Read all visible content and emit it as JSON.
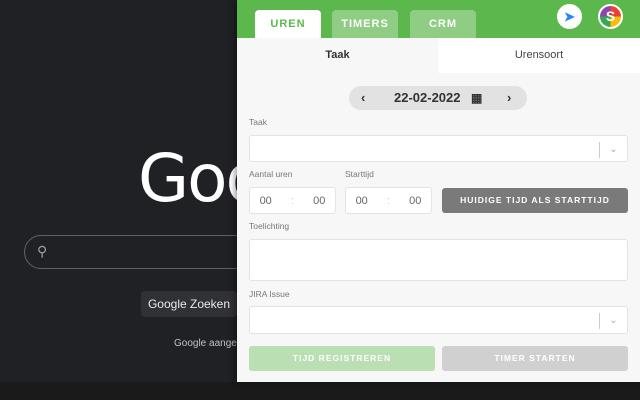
{
  "background": {
    "logo": "Goo",
    "search_icon": "search-icon",
    "search_button": "Google Zoeken",
    "language_text": "Google aangeb"
  },
  "header": {
    "tabs": [
      {
        "label": "UREN",
        "active": true
      },
      {
        "label": "TIMERS"
      },
      {
        "label": "CRM"
      }
    ],
    "jira_icon": "jira-icon",
    "avatar_letter": "S"
  },
  "subtabs": [
    {
      "label": "Taak"
    },
    {
      "label": "Urensoort"
    }
  ],
  "date": {
    "value": "22-02-2022",
    "prev": "‹",
    "next": "›",
    "calendar_icon": "▦"
  },
  "form": {
    "taak_label": "Taak",
    "aantal_uren_label": "Aantal uren",
    "aantal_uren": {
      "hours": "00",
      "minutes": "00"
    },
    "starttijd_label": "Starttijd",
    "starttijd": {
      "hours": "00",
      "minutes": "00"
    },
    "sep": ":",
    "now_button": "HUIDIGE TIJD ALS STARTTIJD",
    "toelichting_label": "Toelichting",
    "jira_label": "JIRA Issue",
    "chevron": "⌄"
  },
  "actions": {
    "register": "TIJD REGISTREREN",
    "timer": "TIMER STARTEN"
  },
  "colors": {
    "green": "#5cb84c",
    "light_green": "#b9dfb2",
    "gray_button": "#7a7a7a"
  }
}
